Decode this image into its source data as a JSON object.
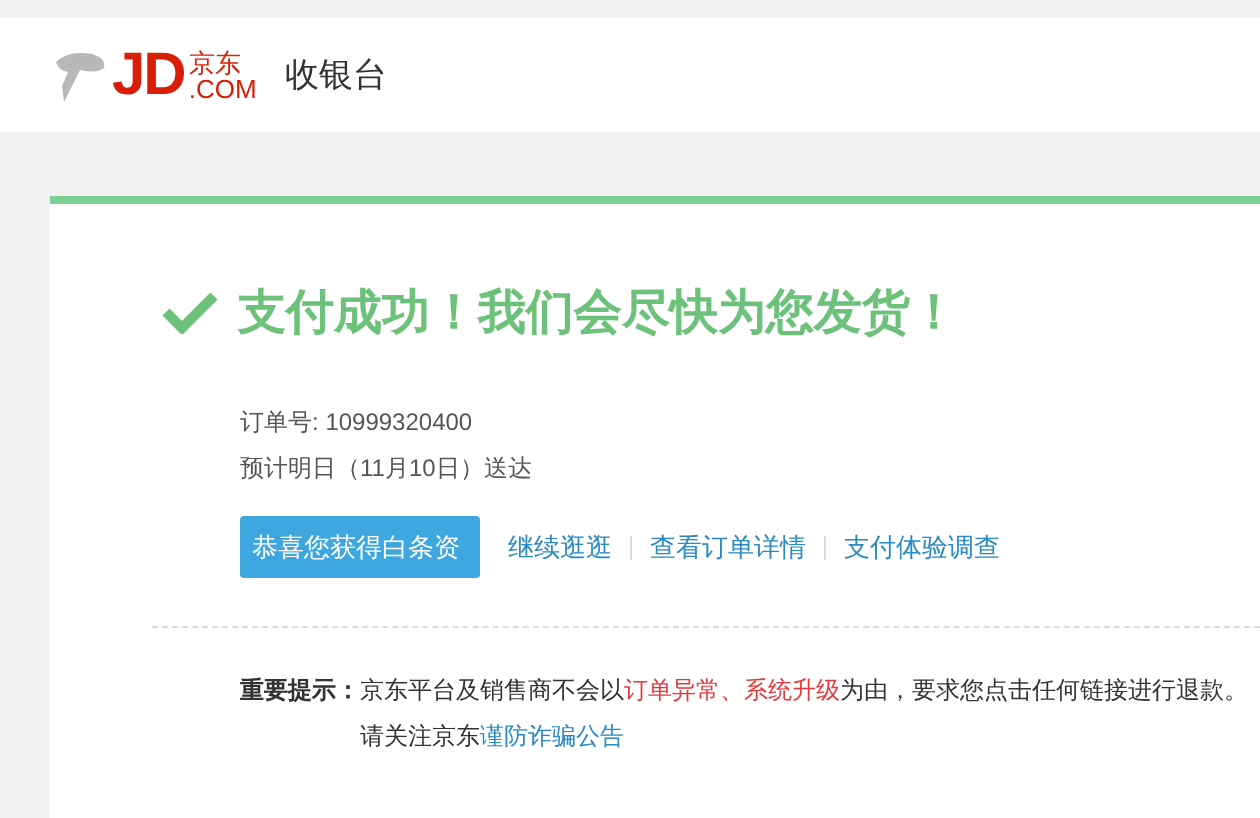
{
  "header": {
    "logo_text": "JD",
    "logo_cn": "京东",
    "logo_com": ".COM",
    "title": "收银台"
  },
  "result": {
    "heading": "支付成功！我们会尽快为您发货！",
    "order_label": "订单号:",
    "order_number": "10999320400",
    "delivery": "预计明日（11月10日）送达"
  },
  "actions": {
    "promo_button": "恭喜您获得白条资",
    "links": [
      {
        "label": "继续逛逛"
      },
      {
        "label": "查看订单详情"
      },
      {
        "label": "支付体验调查"
      }
    ]
  },
  "notice": {
    "label": "重要提示：",
    "segments": [
      {
        "kind": "plain",
        "text": "京东平台及销售商不会以"
      },
      {
        "kind": "warning",
        "text": "订单异常、系统升级"
      },
      {
        "kind": "plain",
        "text": "为由，要求您点击任何链接进行退款。"
      }
    ],
    "follow_text": "请关注京东",
    "follow_link": "谨防诈骗公告"
  }
}
